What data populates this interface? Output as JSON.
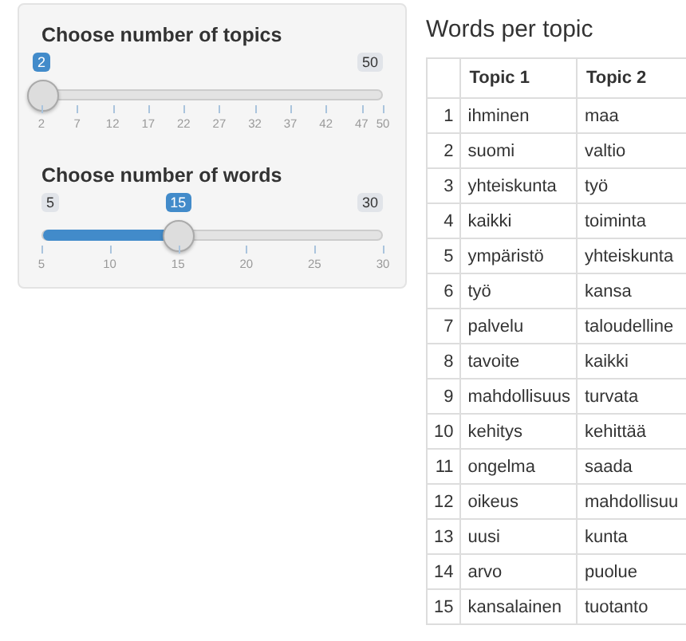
{
  "sliders": [
    {
      "label": "Choose number of topics",
      "max": "50",
      "value": "2",
      "level": 0,
      "ticks": [
        "2",
        "7",
        "12",
        "17",
        "22",
        "27",
        "32",
        "37",
        "42",
        "47",
        "50"
      ]
    },
    {
      "label": "Choose number of words",
      "min": "5",
      "max": "30",
      "value": "15",
      "level": 0.4,
      "ticks": [
        "5",
        "10",
        "15",
        "20",
        "25",
        "30"
      ]
    }
  ],
  "table": {
    "title": "Words per topic",
    "columns": [
      "",
      "Topic 1",
      "Topic 2"
    ],
    "rows": [
      [
        "1",
        "ihminen",
        "maa"
      ],
      [
        "2",
        "suomi",
        "valtio"
      ],
      [
        "3",
        "yhteiskunta",
        "työ"
      ],
      [
        "4",
        "kaikki",
        "toiminta"
      ],
      [
        "5",
        "ympäristö",
        "yhteiskunta"
      ],
      [
        "6",
        "työ",
        "kansa"
      ],
      [
        "7",
        "palvelu",
        "taloudelline"
      ],
      [
        "8",
        "tavoite",
        "kaikki"
      ],
      [
        "9",
        "mahdollisuus",
        "turvata"
      ],
      [
        "10",
        "kehitys",
        "kehittää"
      ],
      [
        "11",
        "ongelma",
        "saada"
      ],
      [
        "12",
        "oikeus",
        "mahdollisuu"
      ],
      [
        "13",
        "uusi",
        "kunta"
      ],
      [
        "14",
        "arvo",
        "puolue"
      ],
      [
        "15",
        "kansalainen",
        "tuotanto"
      ]
    ]
  }
}
